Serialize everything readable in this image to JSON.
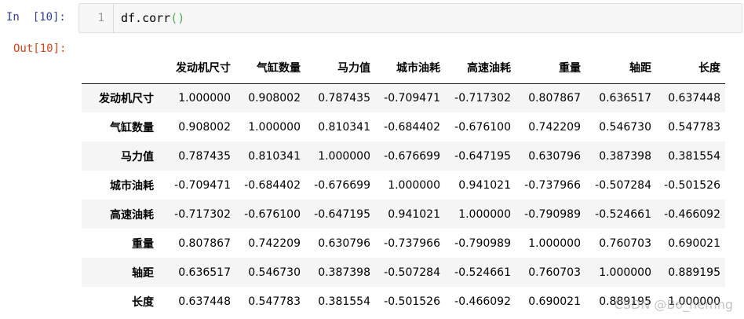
{
  "cell": {
    "in_prompt": "In  [10]:",
    "out_prompt": "Out[10]:",
    "line_number": "1",
    "code_prefix": "df.corr",
    "code_parens": "()"
  },
  "table": {
    "columns": [
      "发动机尺寸",
      "气缸数量",
      "马力值",
      "城市油耗",
      "高速油耗",
      "重量",
      "轴距",
      "长度"
    ],
    "rows": [
      {
        "label": "发动机尺寸",
        "values": [
          "1.000000",
          "0.908002",
          "0.787435",
          "-0.709471",
          "-0.717302",
          "0.807867",
          "0.636517",
          "0.637448"
        ]
      },
      {
        "label": "气缸数量",
        "values": [
          "0.908002",
          "1.000000",
          "0.810341",
          "-0.684402",
          "-0.676100",
          "0.742209",
          "0.546730",
          "0.547783"
        ]
      },
      {
        "label": "马力值",
        "values": [
          "0.787435",
          "0.810341",
          "1.000000",
          "-0.676699",
          "-0.647195",
          "0.630796",
          "0.387398",
          "0.381554"
        ]
      },
      {
        "label": "城市油耗",
        "values": [
          "-0.709471",
          "-0.684402",
          "-0.676699",
          "1.000000",
          "0.941021",
          "-0.737966",
          "-0.507284",
          "-0.501526"
        ]
      },
      {
        "label": "高速油耗",
        "values": [
          "-0.717302",
          "-0.676100",
          "-0.647195",
          "0.941021",
          "1.000000",
          "-0.790989",
          "-0.524661",
          "-0.466092"
        ]
      },
      {
        "label": "重量",
        "values": [
          "0.807867",
          "0.742209",
          "0.630796",
          "-0.737966",
          "-0.790989",
          "1.000000",
          "0.760703",
          "0.690021"
        ]
      },
      {
        "label": "轴距",
        "values": [
          "0.636517",
          "0.546730",
          "0.387398",
          "-0.507284",
          "-0.524661",
          "0.760703",
          "1.000000",
          "0.889195"
        ]
      },
      {
        "label": "长度",
        "values": [
          "0.637448",
          "0.547783",
          "0.381554",
          "-0.501526",
          "-0.466092",
          "0.690021",
          "0.889195",
          "1.000000"
        ]
      }
    ]
  },
  "watermark": "CSDN @Bo_hemng",
  "colors": {
    "in_prompt": "#303f9f",
    "out_prompt": "#d84315",
    "paren": "#4caf50",
    "stripe": "#f5f5f5"
  }
}
